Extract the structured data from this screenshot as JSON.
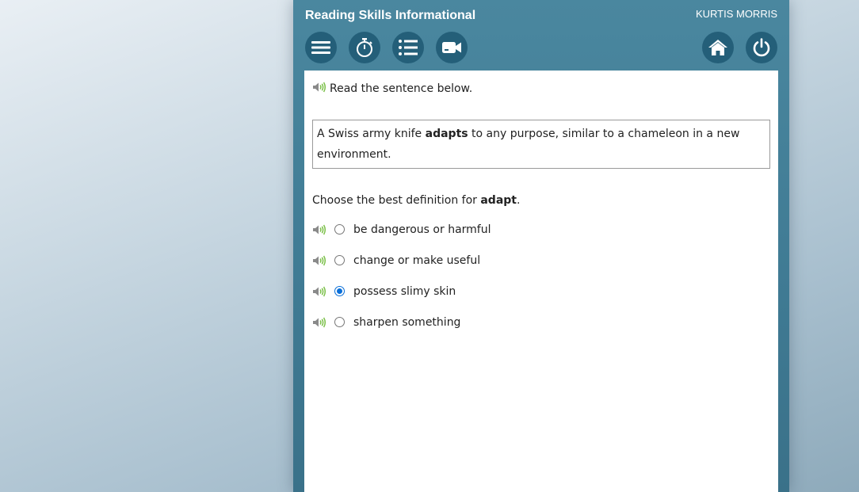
{
  "header": {
    "title": "Reading Skills Informational",
    "user": "KURTIS MORRIS"
  },
  "toolbar": {
    "left_buttons": [
      {
        "icon": "menu-icon"
      },
      {
        "icon": "stopwatch-icon"
      },
      {
        "icon": "list-icon"
      },
      {
        "icon": "video-camera-icon"
      }
    ],
    "right_buttons": [
      {
        "icon": "home-icon"
      },
      {
        "icon": "power-icon"
      }
    ]
  },
  "content": {
    "instruction": "Read the sentence below.",
    "passage": {
      "before": "A Swiss army knife ",
      "bold": "adapts",
      "after": " to any purpose, similar to a chameleon in a new environment."
    },
    "question": {
      "before": "Choose the best definition for ",
      "bold": "adapt",
      "after": "."
    },
    "options": [
      {
        "label": "be dangerous or harmful",
        "selected": false
      },
      {
        "label": "change or make useful",
        "selected": false
      },
      {
        "label": "possess slimy skin",
        "selected": true
      },
      {
        "label": "sharpen something",
        "selected": false
      }
    ]
  },
  "colors": {
    "panel": "#3f7a93",
    "button": "#245f79",
    "speaker_wave": "#7cc04a",
    "radio_selected": "#0a6fd8"
  }
}
